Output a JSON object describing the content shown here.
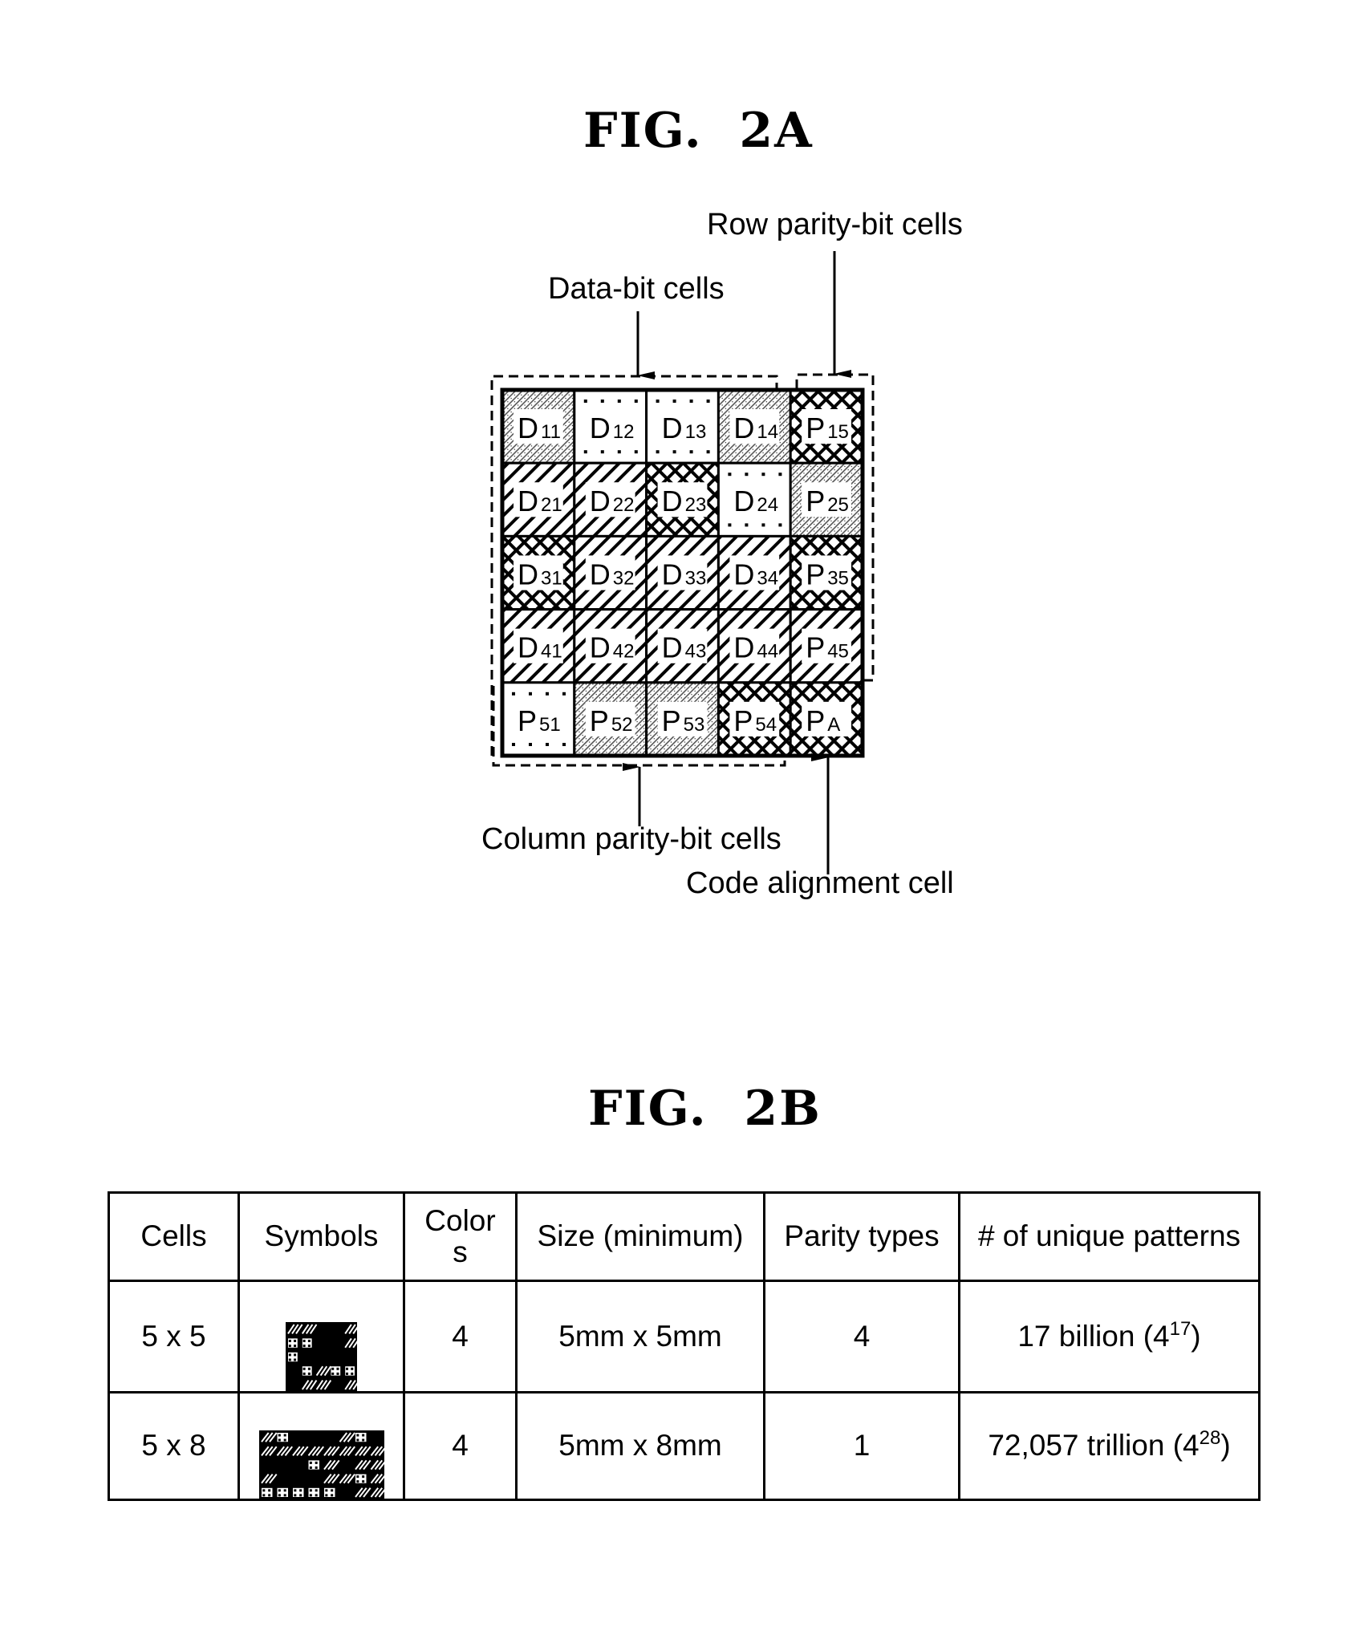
{
  "fig2a": {
    "title": "FIG.  2A",
    "labels": {
      "data_bit_cells": "Data-bit cells",
      "row_parity_bit_cells": "Row parity-bit cells",
      "column_parity_bit_cells": "Column parity-bit cells",
      "code_alignment_cell": "Code alignment cell"
    },
    "grid": [
      [
        {
          "letter": "D",
          "sub": "11",
          "pattern": "stipple"
        },
        {
          "letter": "D",
          "sub": "12",
          "pattern": "dots"
        },
        {
          "letter": "D",
          "sub": "13",
          "pattern": "dots"
        },
        {
          "letter": "D",
          "sub": "14",
          "pattern": "stipple"
        },
        {
          "letter": "P",
          "sub": "15",
          "pattern": "cross"
        }
      ],
      [
        {
          "letter": "D",
          "sub": "21",
          "pattern": "hatch"
        },
        {
          "letter": "D",
          "sub": "22",
          "pattern": "hatch"
        },
        {
          "letter": "D",
          "sub": "23",
          "pattern": "cross"
        },
        {
          "letter": "D",
          "sub": "24",
          "pattern": "dots"
        },
        {
          "letter": "P",
          "sub": "25",
          "pattern": "stipple"
        }
      ],
      [
        {
          "letter": "D",
          "sub": "31",
          "pattern": "cross"
        },
        {
          "letter": "D",
          "sub": "32",
          "pattern": "hatch"
        },
        {
          "letter": "D",
          "sub": "33",
          "pattern": "hatch"
        },
        {
          "letter": "D",
          "sub": "34",
          "pattern": "hatch"
        },
        {
          "letter": "P",
          "sub": "35",
          "pattern": "cross"
        }
      ],
      [
        {
          "letter": "D",
          "sub": "41",
          "pattern": "hatch"
        },
        {
          "letter": "D",
          "sub": "42",
          "pattern": "hatch"
        },
        {
          "letter": "D",
          "sub": "43",
          "pattern": "hatch"
        },
        {
          "letter": "D",
          "sub": "44",
          "pattern": "hatch"
        },
        {
          "letter": "P",
          "sub": "45",
          "pattern": "hatch"
        }
      ],
      [
        {
          "letter": "P",
          "sub": "51",
          "pattern": "dots"
        },
        {
          "letter": "P",
          "sub": "52",
          "pattern": "stipple"
        },
        {
          "letter": "P",
          "sub": "53",
          "pattern": "stipple"
        },
        {
          "letter": "P",
          "sub": "54",
          "pattern": "cross"
        },
        {
          "letter": "P",
          "sub": "A",
          "pattern": "cross"
        }
      ]
    ]
  },
  "fig2b": {
    "title": "FIG.  2B",
    "table": {
      "headers": {
        "cells": "Cells",
        "symbols": "Symbols",
        "colors_line1": "Color",
        "colors_line2": "s",
        "size": "Size (minimum)",
        "parity": "Parity types",
        "patterns": "# of unique patterns"
      },
      "rows": [
        {
          "cells": "5 x 5",
          "symbol": "5x5-symbol-thumbnail",
          "colors": "4",
          "size": "5mm x 5mm",
          "parity": "4",
          "patterns_text": "17 billion (4",
          "patterns_exp": "17",
          "patterns_close": ")"
        },
        {
          "cells": "5 x 8",
          "symbol": "5x8-symbol-thumbnail",
          "colors": "4",
          "size": "5mm x 8mm",
          "parity": "1",
          "patterns_text": "72,057 trillion (4",
          "patterns_exp": "28",
          "patterns_close": ")"
        }
      ]
    }
  }
}
